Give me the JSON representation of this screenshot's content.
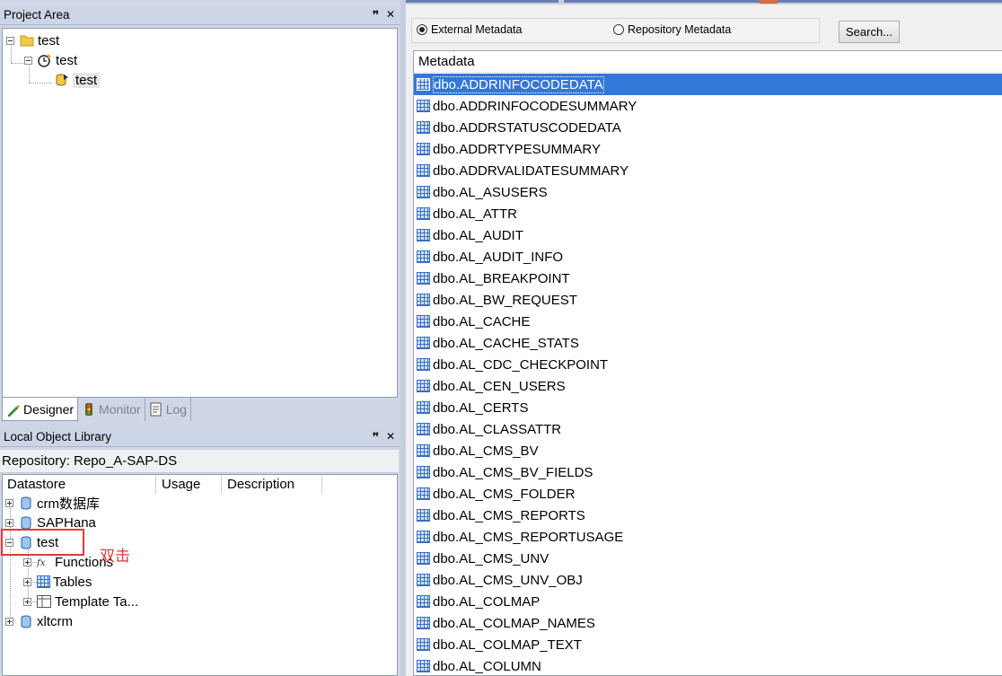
{
  "project_area": {
    "title": "Project Area",
    "pin": "ꟸ",
    "close": "✕",
    "tree": [
      {
        "label": "test",
        "icon": "folder-icon"
      },
      {
        "label": "test",
        "icon": "job-icon"
      },
      {
        "label": "test",
        "icon": "dataflow-icon"
      }
    ]
  },
  "tabs": [
    {
      "label": "Designer",
      "icon": "designer-icon",
      "active": true
    },
    {
      "label": "Monitor",
      "icon": "traffic-light-icon",
      "active": false
    },
    {
      "label": "Log",
      "icon": "log-icon",
      "active": false
    }
  ],
  "local_library": {
    "title": "Local Object Library",
    "repository": "Repository: Repo_A-SAP-DS",
    "columns": [
      "Datastore",
      "Usage",
      "Description"
    ],
    "tree": [
      {
        "label": "crm数据库",
        "expander": "plus"
      },
      {
        "label": "SAPHana",
        "expander": "plus"
      },
      {
        "label": "test",
        "expander": "minus"
      },
      {
        "label": "Functions",
        "expander": "plus"
      },
      {
        "label": "Tables",
        "expander": "plus"
      },
      {
        "label": "Template Ta...",
        "expander": "plus"
      },
      {
        "label": "xltcrm",
        "expander": "plus"
      }
    ],
    "annotation": "双击"
  },
  "metadata_panel": {
    "external_label": "External Metadata",
    "repository_label": "Repository Metadata",
    "search_label": "Search...",
    "list_header": "Metadata",
    "items": [
      "dbo.ADDRINFOCODEDATA",
      "dbo.ADDRINFOCODESUMMARY",
      "dbo.ADDRSTATUSCODEDATA",
      "dbo.ADDRTYPESUMMARY",
      "dbo.ADDRVALIDATESUMMARY",
      "dbo.AL_ASUSERS",
      "dbo.AL_ATTR",
      "dbo.AL_AUDIT",
      "dbo.AL_AUDIT_INFO",
      "dbo.AL_BREAKPOINT",
      "dbo.AL_BW_REQUEST",
      "dbo.AL_CACHE",
      "dbo.AL_CACHE_STATS",
      "dbo.AL_CDC_CHECKPOINT",
      "dbo.AL_CEN_USERS",
      "dbo.AL_CERTS",
      "dbo.AL_CLASSATTR",
      "dbo.AL_CMS_BV",
      "dbo.AL_CMS_BV_FIELDS",
      "dbo.AL_CMS_FOLDER",
      "dbo.AL_CMS_REPORTS",
      "dbo.AL_CMS_REPORTUSAGE",
      "dbo.AL_CMS_UNV",
      "dbo.AL_CMS_UNV_OBJ",
      "dbo.AL_COLMAP",
      "dbo.AL_COLMAP_NAMES",
      "dbo.AL_COLMAP_TEXT",
      "dbo.AL_COLUMN"
    ]
  },
  "colors": {
    "selection": "#3377d9",
    "annotation": "#e03a3a"
  }
}
